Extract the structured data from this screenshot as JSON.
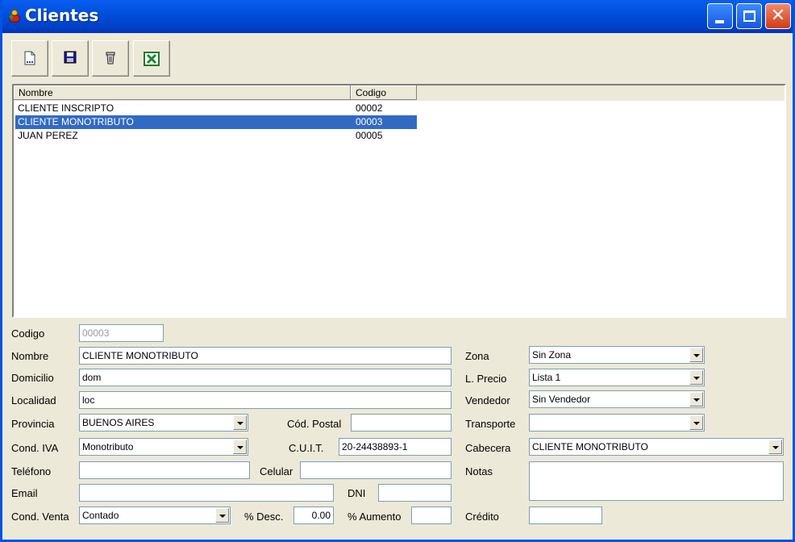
{
  "window": {
    "title": "Clientes"
  },
  "toolbar": {
    "buttons": [
      {
        "name": "new-document-button",
        "icon": "new-document-icon"
      },
      {
        "name": "save-button",
        "icon": "floppy-disk-icon"
      },
      {
        "name": "delete-button",
        "icon": "trash-icon"
      },
      {
        "name": "export-excel-button",
        "icon": "excel-icon"
      }
    ]
  },
  "list": {
    "columns": [
      "Nombre",
      "Codigo"
    ],
    "rows": [
      {
        "nombre": "CLIENTE INSCRIPTO",
        "codigo": "00002",
        "selected": false
      },
      {
        "nombre": "CLIENTE MONOTRIBUTO",
        "codigo": "00003",
        "selected": true
      },
      {
        "nombre": "JUAN PEREZ",
        "codigo": "00005",
        "selected": false
      }
    ]
  },
  "form": {
    "labels": {
      "codigo": "Codigo",
      "nombre": "Nombre",
      "domicilio": "Domicilio",
      "localidad": "Localidad",
      "provincia": "Provincia",
      "cod_postal": "Cód. Postal",
      "cond_iva": "Cond. IVA",
      "cuit": "C.U.I.T.",
      "telefono": "Teléfono",
      "celular": "Celular",
      "email": "Email",
      "dni": "DNI",
      "cond_venta": "Cond. Venta",
      "desc": "% Desc.",
      "aumento": "% Aumento",
      "zona": "Zona",
      "lprecio": "L. Precio",
      "vendedor": "Vendedor",
      "transporte": "Transporte",
      "cabecera": "Cabecera",
      "notas": "Notas",
      "credito": "Crédito"
    },
    "values": {
      "codigo": "00003",
      "nombre": "CLIENTE MONOTRIBUTO",
      "domicilio": "dom",
      "localidad": "loc",
      "provincia": "BUENOS AIRES",
      "cod_postal": "",
      "cond_iva": "Monotributo",
      "cuit": "20-24438893-1",
      "telefono": "",
      "celular": "",
      "email": "",
      "dni": "",
      "cond_venta": "Contado",
      "desc": "0.00",
      "aumento": "",
      "zona": "Sin Zona",
      "lprecio": "Lista 1",
      "vendedor": "Sin Vendedor",
      "transporte": "",
      "cabecera": "CLIENTE MONOTRIBUTO",
      "notas": "",
      "credito": ""
    }
  }
}
